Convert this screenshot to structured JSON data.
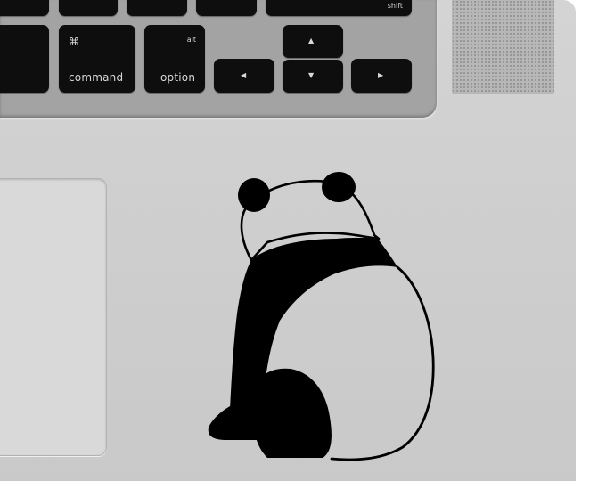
{
  "keys": {
    "command": {
      "label": "command",
      "symbol": "⌘"
    },
    "option": {
      "label": "option",
      "alt": "alt"
    },
    "shift": {
      "label": "shift"
    },
    "arrows": {
      "up": "▲",
      "down": "▼",
      "left": "◀",
      "right": "▶"
    }
  },
  "colors": {
    "aluminum": "#cfcfcf",
    "key": "#0e0e0e",
    "decal": "#000000"
  },
  "decal": {
    "subject": "panda-icon"
  }
}
